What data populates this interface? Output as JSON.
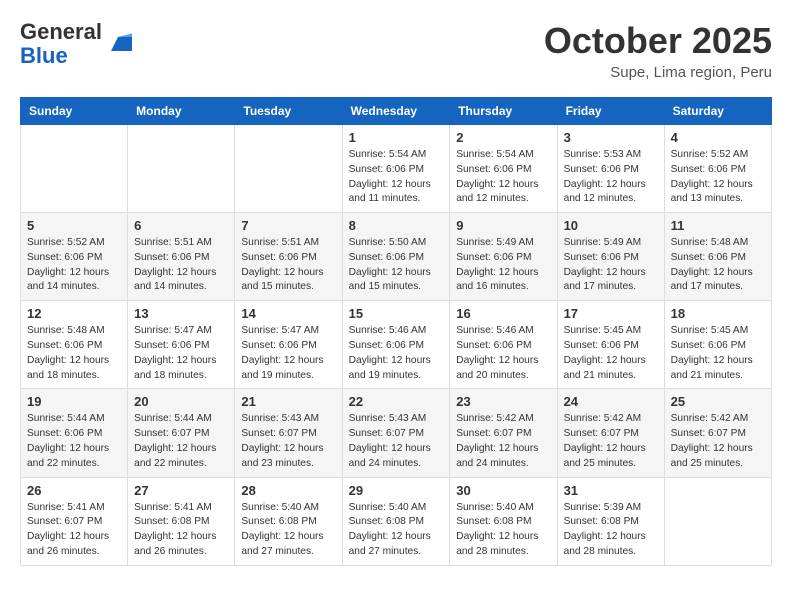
{
  "header": {
    "logo_general": "General",
    "logo_blue": "Blue",
    "month_title": "October 2025",
    "subtitle": "Supe, Lima region, Peru"
  },
  "days_of_week": [
    "Sunday",
    "Monday",
    "Tuesday",
    "Wednesday",
    "Thursday",
    "Friday",
    "Saturday"
  ],
  "weeks": [
    [
      {
        "day": "",
        "info": ""
      },
      {
        "day": "",
        "info": ""
      },
      {
        "day": "",
        "info": ""
      },
      {
        "day": "1",
        "info": "Sunrise: 5:54 AM\nSunset: 6:06 PM\nDaylight: 12 hours\nand 11 minutes."
      },
      {
        "day": "2",
        "info": "Sunrise: 5:54 AM\nSunset: 6:06 PM\nDaylight: 12 hours\nand 12 minutes."
      },
      {
        "day": "3",
        "info": "Sunrise: 5:53 AM\nSunset: 6:06 PM\nDaylight: 12 hours\nand 12 minutes."
      },
      {
        "day": "4",
        "info": "Sunrise: 5:52 AM\nSunset: 6:06 PM\nDaylight: 12 hours\nand 13 minutes."
      }
    ],
    [
      {
        "day": "5",
        "info": "Sunrise: 5:52 AM\nSunset: 6:06 PM\nDaylight: 12 hours\nand 14 minutes."
      },
      {
        "day": "6",
        "info": "Sunrise: 5:51 AM\nSunset: 6:06 PM\nDaylight: 12 hours\nand 14 minutes."
      },
      {
        "day": "7",
        "info": "Sunrise: 5:51 AM\nSunset: 6:06 PM\nDaylight: 12 hours\nand 15 minutes."
      },
      {
        "day": "8",
        "info": "Sunrise: 5:50 AM\nSunset: 6:06 PM\nDaylight: 12 hours\nand 15 minutes."
      },
      {
        "day": "9",
        "info": "Sunrise: 5:49 AM\nSunset: 6:06 PM\nDaylight: 12 hours\nand 16 minutes."
      },
      {
        "day": "10",
        "info": "Sunrise: 5:49 AM\nSunset: 6:06 PM\nDaylight: 12 hours\nand 17 minutes."
      },
      {
        "day": "11",
        "info": "Sunrise: 5:48 AM\nSunset: 6:06 PM\nDaylight: 12 hours\nand 17 minutes."
      }
    ],
    [
      {
        "day": "12",
        "info": "Sunrise: 5:48 AM\nSunset: 6:06 PM\nDaylight: 12 hours\nand 18 minutes."
      },
      {
        "day": "13",
        "info": "Sunrise: 5:47 AM\nSunset: 6:06 PM\nDaylight: 12 hours\nand 18 minutes."
      },
      {
        "day": "14",
        "info": "Sunrise: 5:47 AM\nSunset: 6:06 PM\nDaylight: 12 hours\nand 19 minutes."
      },
      {
        "day": "15",
        "info": "Sunrise: 5:46 AM\nSunset: 6:06 PM\nDaylight: 12 hours\nand 19 minutes."
      },
      {
        "day": "16",
        "info": "Sunrise: 5:46 AM\nSunset: 6:06 PM\nDaylight: 12 hours\nand 20 minutes."
      },
      {
        "day": "17",
        "info": "Sunrise: 5:45 AM\nSunset: 6:06 PM\nDaylight: 12 hours\nand 21 minutes."
      },
      {
        "day": "18",
        "info": "Sunrise: 5:45 AM\nSunset: 6:06 PM\nDaylight: 12 hours\nand 21 minutes."
      }
    ],
    [
      {
        "day": "19",
        "info": "Sunrise: 5:44 AM\nSunset: 6:06 PM\nDaylight: 12 hours\nand 22 minutes."
      },
      {
        "day": "20",
        "info": "Sunrise: 5:44 AM\nSunset: 6:07 PM\nDaylight: 12 hours\nand 22 minutes."
      },
      {
        "day": "21",
        "info": "Sunrise: 5:43 AM\nSunset: 6:07 PM\nDaylight: 12 hours\nand 23 minutes."
      },
      {
        "day": "22",
        "info": "Sunrise: 5:43 AM\nSunset: 6:07 PM\nDaylight: 12 hours\nand 24 minutes."
      },
      {
        "day": "23",
        "info": "Sunrise: 5:42 AM\nSunset: 6:07 PM\nDaylight: 12 hours\nand 24 minutes."
      },
      {
        "day": "24",
        "info": "Sunrise: 5:42 AM\nSunset: 6:07 PM\nDaylight: 12 hours\nand 25 minutes."
      },
      {
        "day": "25",
        "info": "Sunrise: 5:42 AM\nSunset: 6:07 PM\nDaylight: 12 hours\nand 25 minutes."
      }
    ],
    [
      {
        "day": "26",
        "info": "Sunrise: 5:41 AM\nSunset: 6:07 PM\nDaylight: 12 hours\nand 26 minutes."
      },
      {
        "day": "27",
        "info": "Sunrise: 5:41 AM\nSunset: 6:08 PM\nDaylight: 12 hours\nand 26 minutes."
      },
      {
        "day": "28",
        "info": "Sunrise: 5:40 AM\nSunset: 6:08 PM\nDaylight: 12 hours\nand 27 minutes."
      },
      {
        "day": "29",
        "info": "Sunrise: 5:40 AM\nSunset: 6:08 PM\nDaylight: 12 hours\nand 27 minutes."
      },
      {
        "day": "30",
        "info": "Sunrise: 5:40 AM\nSunset: 6:08 PM\nDaylight: 12 hours\nand 28 minutes."
      },
      {
        "day": "31",
        "info": "Sunrise: 5:39 AM\nSunset: 6:08 PM\nDaylight: 12 hours\nand 28 minutes."
      },
      {
        "day": "",
        "info": ""
      }
    ]
  ]
}
